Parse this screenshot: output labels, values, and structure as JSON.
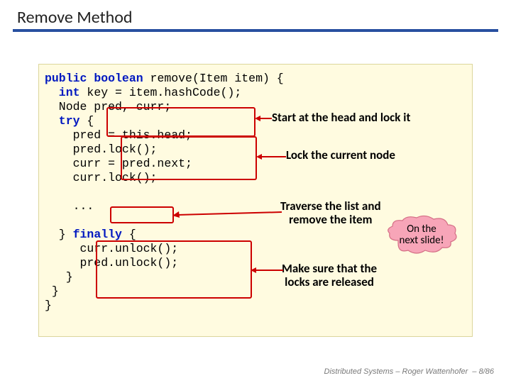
{
  "title": "Remove Method",
  "code": {
    "l1a": "public",
    "l1b": " boolean",
    "l1c": " remove(Item item) {",
    "l2a": "  int",
    "l2b": " key = item.hashCode();",
    "l3": "  Node pred, curr;",
    "l4a": "  try",
    "l4b": " {",
    "l5": "    pred = this.head;",
    "l6": "    pred.lock();",
    "l7": "    curr = pred.next;",
    "l8": "    curr.lock();",
    "blank1": "",
    "l9": "    ...",
    "blank2": "",
    "l10a": "  } ",
    "l10b": "finally",
    "l10c": " {",
    "l11": "     curr.unlock();",
    "l12": "     pred.unlock();",
    "l13": "   }",
    "l14": " }",
    "l15": "}"
  },
  "annotations": {
    "a1": "Start at the head and lock it",
    "a2": "Lock the current node",
    "a3": "Traverse the list and\nremove the item",
    "a4": "Make sure that the\nlocks are released"
  },
  "cloud": "On the\nnext slide!",
  "footer": {
    "course": "Distributed Systems  –  Roger Wattenhofer",
    "page": "– 8/86"
  }
}
